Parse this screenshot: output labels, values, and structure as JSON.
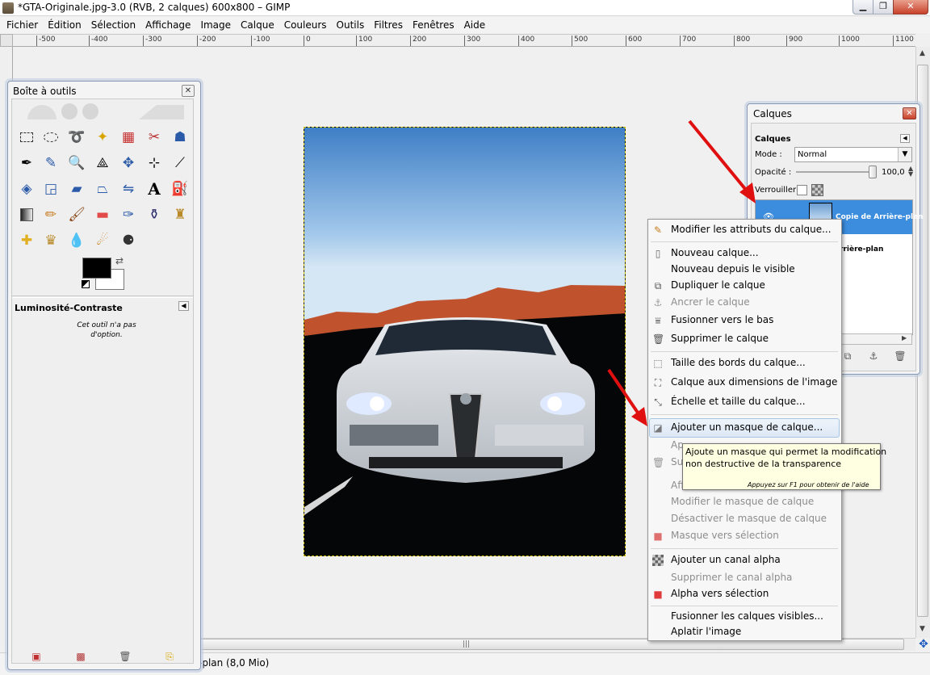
{
  "window": {
    "title": "*GTA-Originale.jpg-3.0 (RVB, 2 calques) 600x800 – GIMP",
    "min_label": "▁",
    "max_label": "❐",
    "close_label": "✕"
  },
  "menubar": {
    "items": [
      "Fichier",
      "Édition",
      "Sélection",
      "Affichage",
      "Image",
      "Calque",
      "Couleurs",
      "Outils",
      "Filtres",
      "Fenêtres",
      "Aide"
    ]
  },
  "ruler": {
    "ticks": [
      "-500",
      "-400",
      "-300",
      "-200",
      "-100",
      "0",
      "100",
      "200",
      "300",
      "400",
      "500",
      "600",
      "700",
      "800",
      "900",
      "1000",
      "1100"
    ]
  },
  "statusbar": {
    "text": "-plan (8,0 Mio)"
  },
  "toolbox": {
    "title": "Boîte à outils",
    "close_label": "✕",
    "options_title": "Luminosité-Contraste",
    "options_message": "Cet outil n'a pas d'option.",
    "tools": [
      "rect-select-icon",
      "ellipse-select-icon",
      "free-select-icon",
      "fuzzy-select-icon",
      "color-select-icon",
      "scissors-icon",
      "foreground-select-icon",
      "paths-icon",
      "color-picker-icon",
      "zoom-icon",
      "measure-icon",
      "move-icon",
      "align-icon",
      "crop-icon",
      "rotate-icon",
      "scale-icon",
      "shear-icon",
      "perspective-icon",
      "flip-icon",
      "text-icon",
      "bucket-fill-icon",
      "blend-icon",
      "pencil-icon",
      "paintbrush-icon",
      "eraser-icon",
      "airbrush-icon",
      "ink-icon",
      "clone-icon",
      "heal-icon",
      "perspective-clone-icon",
      "blur-icon",
      "smudge-icon",
      "dodge-burn-icon"
    ]
  },
  "layers": {
    "title": "Calques",
    "close_label": "✕",
    "subtitle": "Calques",
    "mode_label": "Mode :",
    "mode_value": "Normal",
    "opacity_label": "Opacité :",
    "opacity_value": "100,0",
    "lock_label": "Verrouiller :",
    "items": [
      {
        "name": "Copie de Arrière-plan",
        "selected": true
      },
      {
        "name": "rrière-plan",
        "selected": false
      }
    ]
  },
  "context_menu": {
    "items": [
      {
        "label": "Modifier les attributs du calque...",
        "disabled": false,
        "icon": "edit-attributes-icon"
      },
      {
        "label": "Nouveau calque...",
        "disabled": false,
        "icon": "new-layer-icon"
      },
      {
        "label": "Nouveau depuis le visible",
        "disabled": false,
        "icon": ""
      },
      {
        "label": "Dupliquer le calque",
        "disabled": false,
        "icon": "duplicate-layer-icon"
      },
      {
        "label": "Ancrer le calque",
        "disabled": true,
        "icon": "anchor-icon"
      },
      {
        "label": "Fusionner vers le bas",
        "disabled": false,
        "icon": "merge-down-icon"
      },
      {
        "label": "Supprimer le calque",
        "disabled": false,
        "icon": "delete-layer-icon"
      },
      {
        "label": "Taille des bords du calque...",
        "disabled": false,
        "icon": "layer-boundary-icon"
      },
      {
        "label": "Calque aux dimensions de l'image",
        "disabled": false,
        "icon": "layer-to-image-size-icon"
      },
      {
        "label": "Échelle et taille du calque...",
        "disabled": false,
        "icon": "scale-layer-icon"
      },
      {
        "label": "Ajouter un masque de calque...",
        "disabled": false,
        "icon": "add-mask-icon",
        "highlighted": true
      },
      {
        "label": "Ap",
        "disabled": true,
        "icon": ""
      },
      {
        "label": "Su",
        "disabled": true,
        "icon": "delete-mask-icon"
      },
      {
        "label": "Aff",
        "disabled": true,
        "icon": ""
      },
      {
        "label": "Modifier le masque de calque",
        "disabled": true,
        "icon": ""
      },
      {
        "label": "Désactiver le masque de calque",
        "disabled": true,
        "icon": ""
      },
      {
        "label": "Masque vers sélection",
        "disabled": true,
        "icon": "mask-to-selection-icon"
      },
      {
        "label": "Ajouter un canal alpha",
        "disabled": false,
        "icon": "add-alpha-icon"
      },
      {
        "label": "Supprimer le canal alpha",
        "disabled": true,
        "icon": ""
      },
      {
        "label": "Alpha vers sélection",
        "disabled": false,
        "icon": "alpha-to-selection-icon"
      },
      {
        "label": "Fusionner les calques visibles...",
        "disabled": false,
        "icon": ""
      },
      {
        "label": "Aplatir l'image",
        "disabled": false,
        "icon": ""
      }
    ]
  },
  "tooltip": {
    "line1": "Ajoute un masque qui permet la modification",
    "line2": "non destructive de la transparence",
    "help": "Appuyez sur F1 pour obtenir de l'aide"
  },
  "colors": {
    "accent": "#3c8dde",
    "arrow": "#e01010",
    "tooltip_bg": "#ffffe1"
  }
}
